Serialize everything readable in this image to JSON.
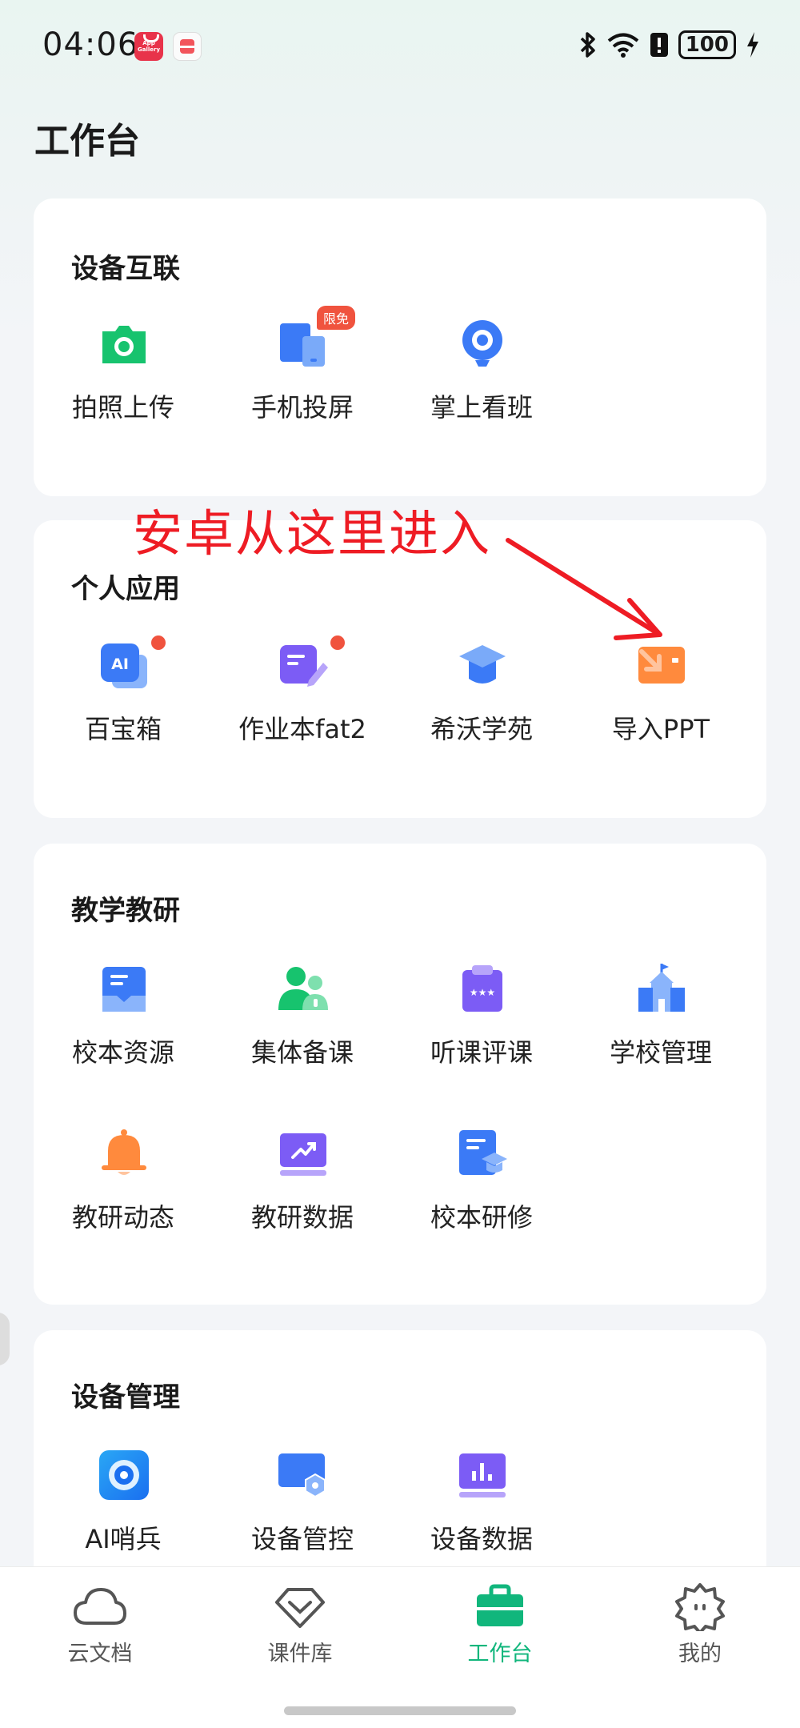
{
  "status_bar": {
    "time": "04:06",
    "app_badge_text": "App Gallery",
    "battery": "100"
  },
  "page_title": "工作台",
  "annotation": "安卓从这里进入",
  "sections": {
    "device_link": {
      "title": "设备互联",
      "items": [
        {
          "label": "拍照上传",
          "icon": "camera-icon"
        },
        {
          "label": "手机投屏",
          "icon": "screen-cast-icon",
          "badge": "限免"
        },
        {
          "label": "掌上看班",
          "icon": "webcam-icon"
        }
      ]
    },
    "personal_apps": {
      "title": "个人应用",
      "items": [
        {
          "label": "百宝箱",
          "icon": "ai-box-icon"
        },
        {
          "label": "作业本fat2",
          "icon": "homework-icon"
        },
        {
          "label": "希沃学苑",
          "icon": "graduation-cap-icon"
        },
        {
          "label": "导入PPT",
          "icon": "import-ppt-icon"
        }
      ]
    },
    "teaching_research": {
      "title": "教学教研",
      "items": [
        {
          "label": "校本资源",
          "icon": "school-resource-icon"
        },
        {
          "label": "集体备课",
          "icon": "group-prep-icon"
        },
        {
          "label": "听课评课",
          "icon": "lesson-review-icon"
        },
        {
          "label": "学校管理",
          "icon": "school-building-icon"
        },
        {
          "label": "教研动态",
          "icon": "bell-icon"
        },
        {
          "label": "教研数据",
          "icon": "trend-chart-icon"
        },
        {
          "label": "校本研修",
          "icon": "training-icon"
        }
      ]
    },
    "device_management": {
      "title": "设备管理",
      "items": [
        {
          "label": "AI哨兵",
          "icon": "ai-sentinel-icon"
        },
        {
          "label": "设备管控",
          "icon": "device-control-icon"
        },
        {
          "label": "设备数据",
          "icon": "device-data-icon"
        }
      ]
    }
  },
  "bottom_nav": [
    {
      "label": "云文档",
      "icon": "cloud-icon",
      "active": false
    },
    {
      "label": "课件库",
      "icon": "diamond-icon",
      "active": false
    },
    {
      "label": "工作台",
      "icon": "briefcase-icon",
      "active": true
    },
    {
      "label": "我的",
      "icon": "profile-face-icon",
      "active": false
    }
  ],
  "colors": {
    "accent": "#11b67c",
    "annotation_red": "#ee1c24",
    "badge_red": "#f0533e"
  }
}
